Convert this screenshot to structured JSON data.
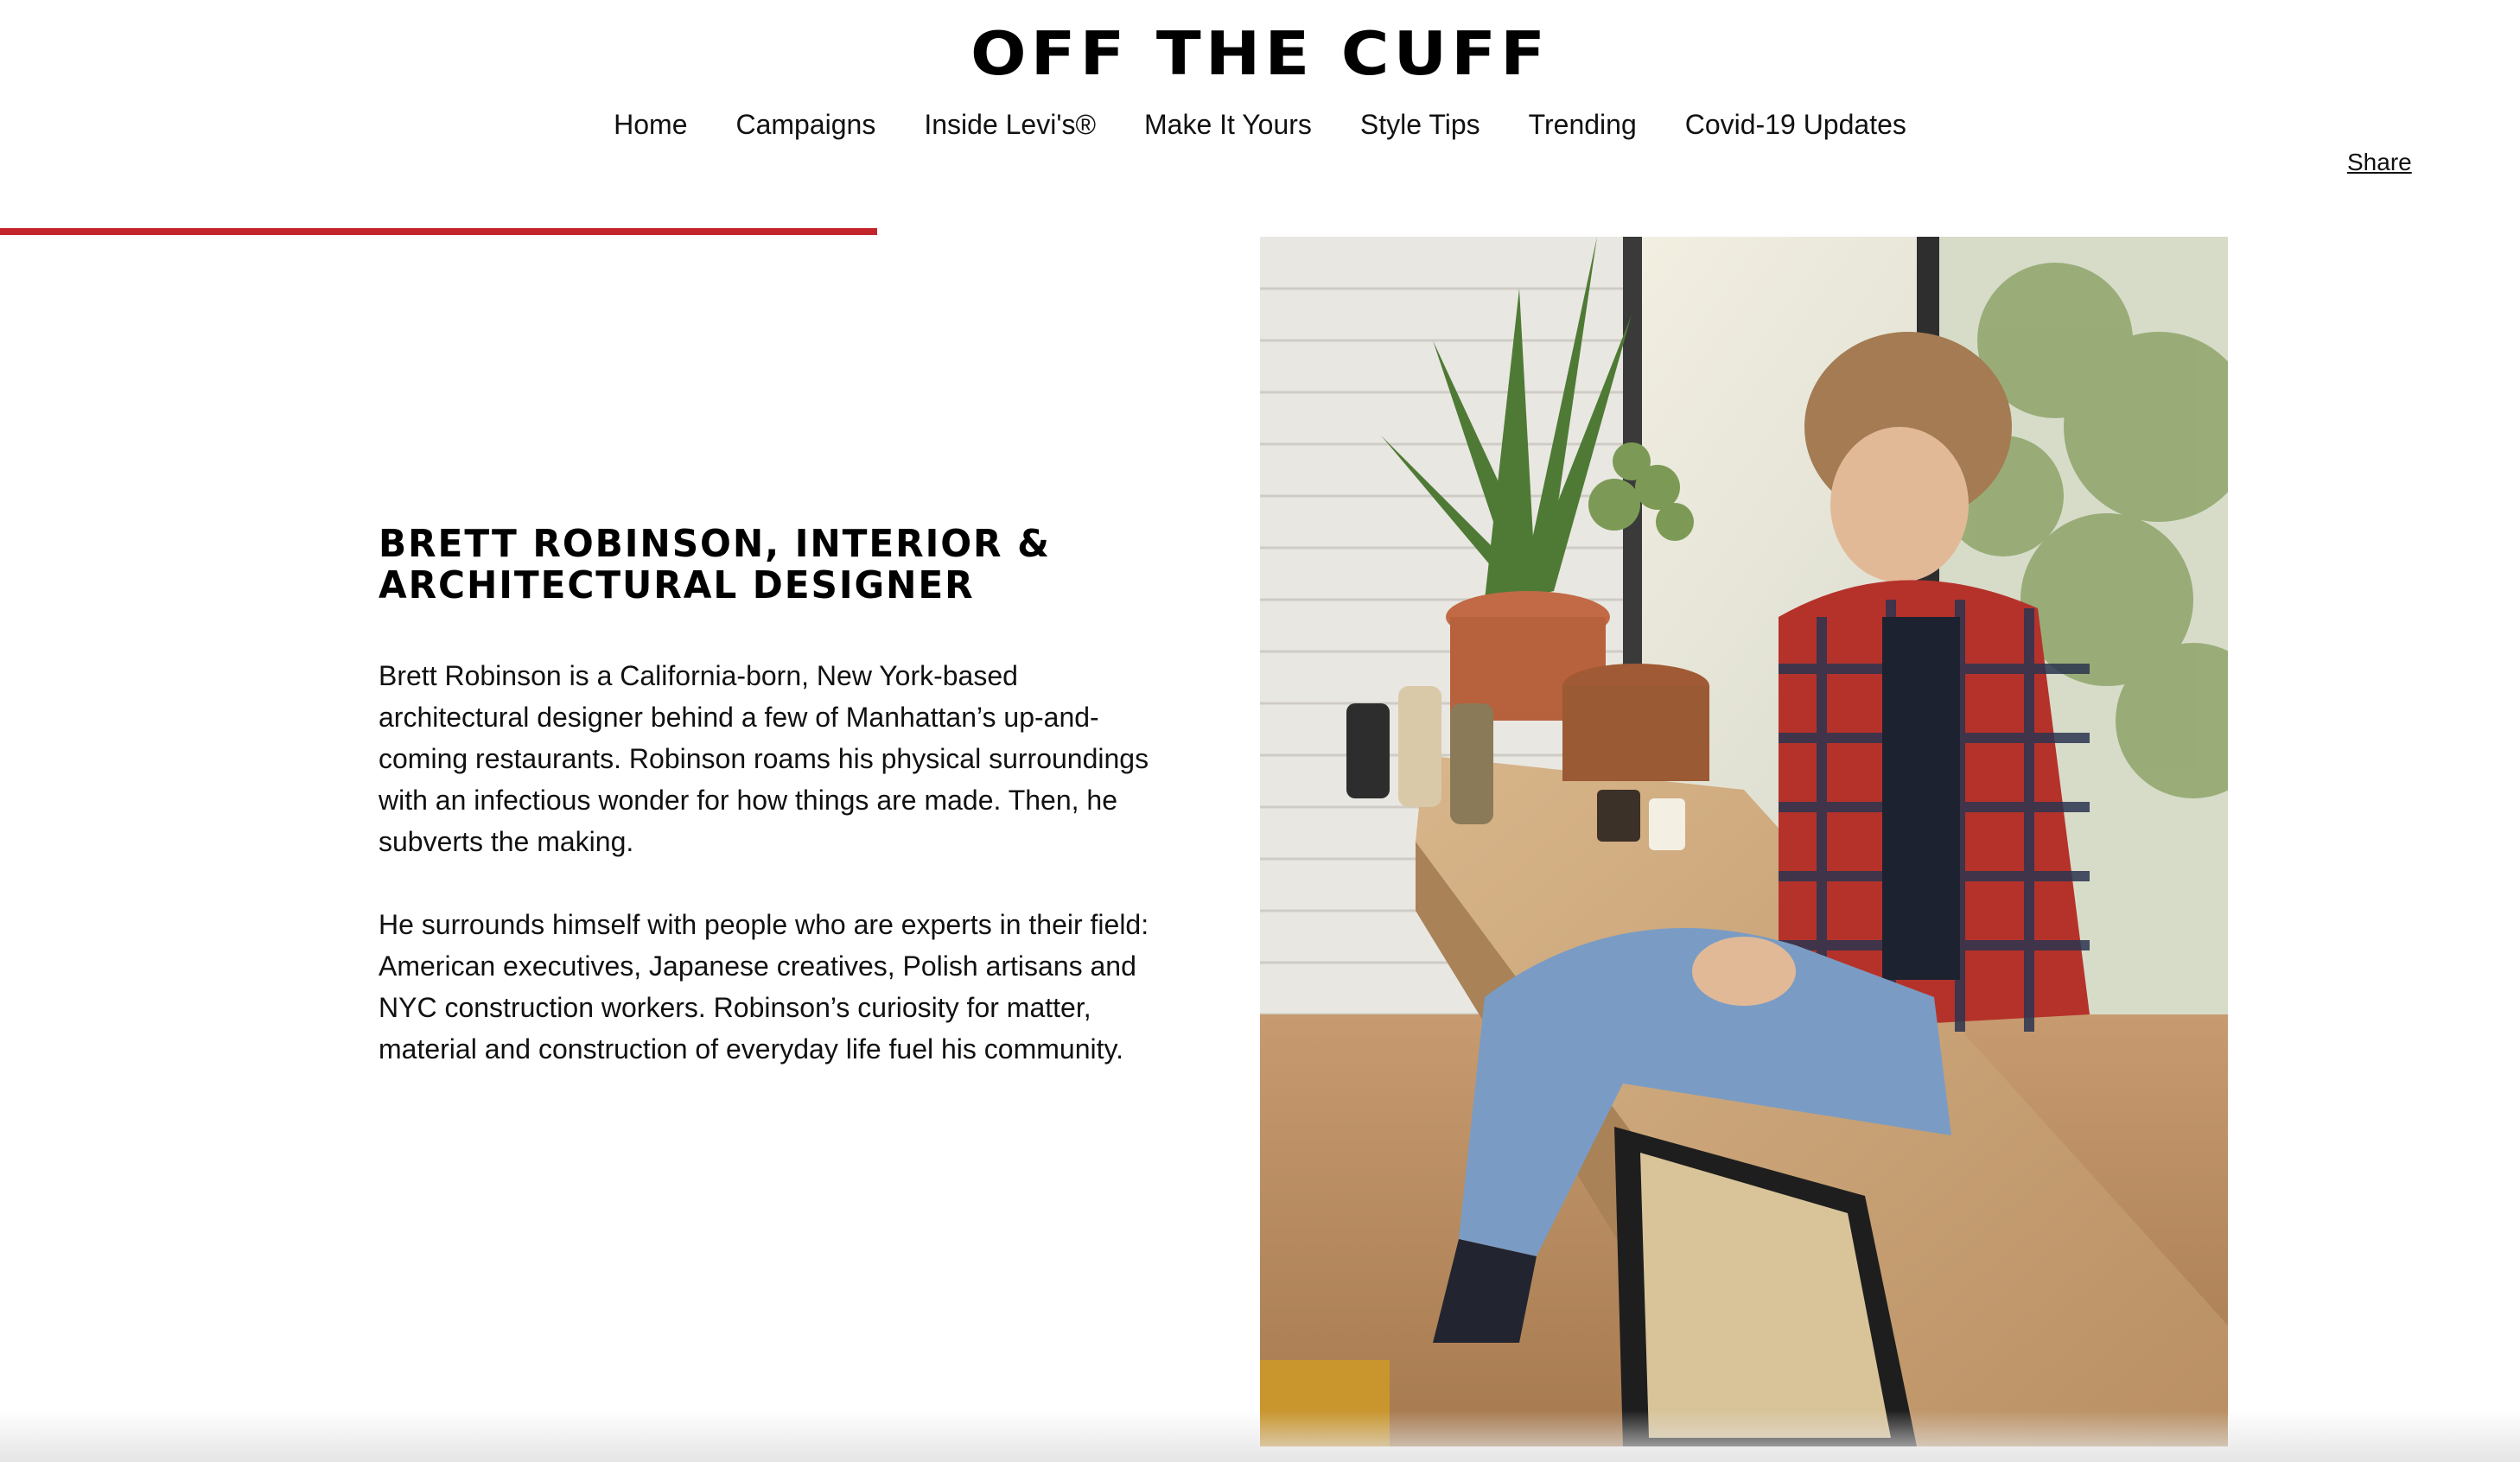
{
  "header": {
    "logo_text": "OFF THE CUFF",
    "nav": [
      {
        "label": "Home"
      },
      {
        "label": "Campaigns"
      },
      {
        "label": "Inside Levi's®"
      },
      {
        "label": "Make It Yours"
      },
      {
        "label": "Style Tips"
      },
      {
        "label": "Trending"
      },
      {
        "label": "Covid-19 Updates"
      }
    ],
    "share_label": "Share"
  },
  "reading_progress": {
    "fraction": 0.348,
    "color": "#c4252b"
  },
  "article": {
    "heading": "BRETT ROBINSON, INTERIOR & ARCHITECTURAL DESIGNER",
    "paragraphs": [
      "Brett Robinson is a California-born, New York-based architectural designer behind a few of Manhattan’s up-and-coming restaurants. Robinson roams his physical surroundings with an infectious wonder for how things are made. Then, he subverts the making.",
      "He surrounds himself with people who are experts in their field: American executives, Japanese creatives, Polish artisans and NYC construction workers. Robinson’s curiosity for matter, material and construction of everyday life fuel his community."
    ]
  },
  "hero_image": {
    "subject": "man in red plaid flannel shirt and jeans sitting on a wooden window ledge with potted plants and ceramic vases"
  }
}
